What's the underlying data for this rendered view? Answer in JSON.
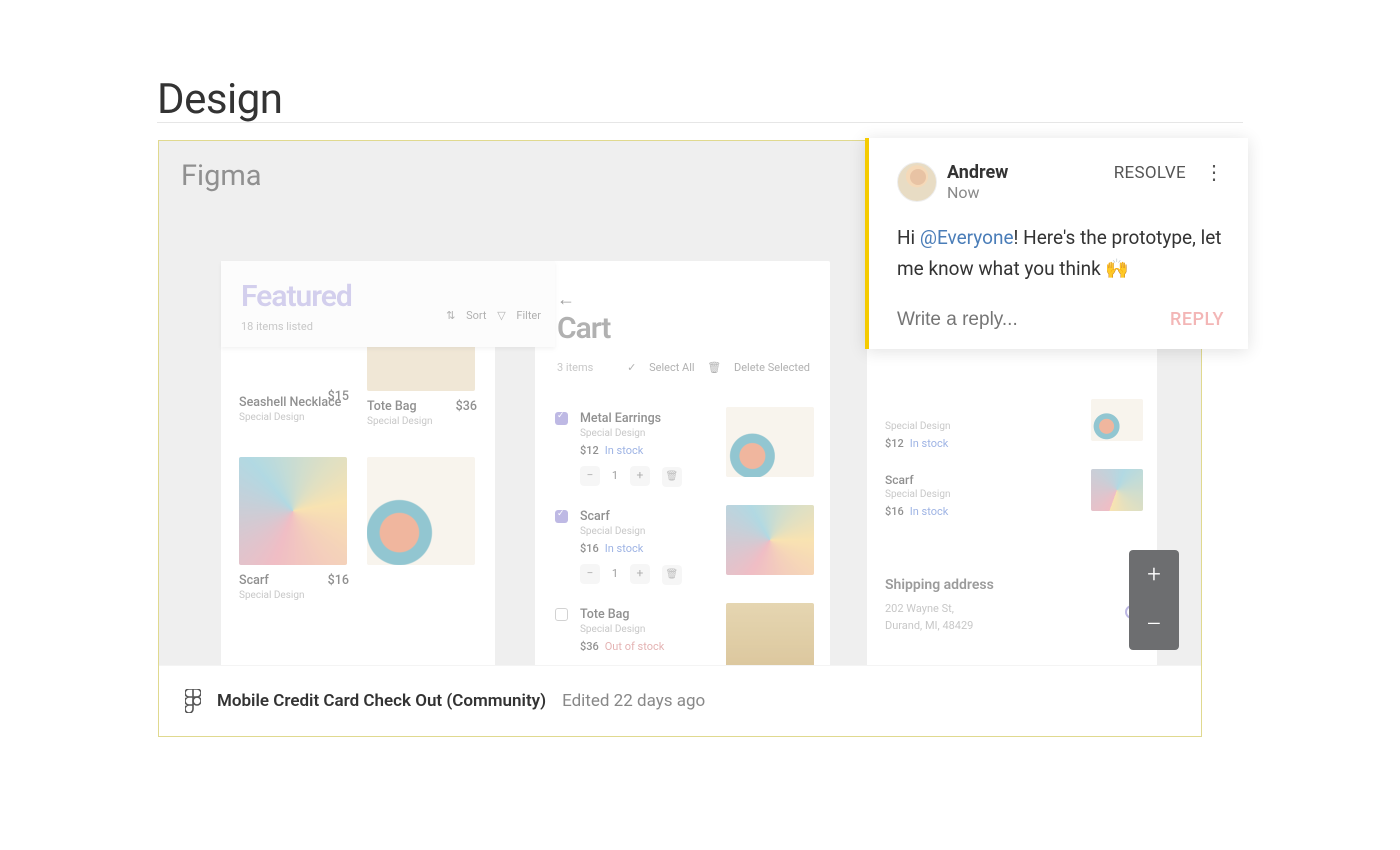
{
  "page": {
    "title": "Design"
  },
  "canvas": {
    "app_label": "Figma"
  },
  "featured": {
    "title": "Featured",
    "subtitle": "18 items listed",
    "sort": "Sort",
    "filter": "Filter"
  },
  "products": {
    "seashell": {
      "name": "Seashell Necklace",
      "sub": "Special Design",
      "price": "$15"
    },
    "tote": {
      "name": "Tote Bag",
      "sub": "Special Design",
      "price": "$36"
    },
    "scarf": {
      "name": "Scarf",
      "sub": "Special Design",
      "price": "$16"
    }
  },
  "cart": {
    "title": "Cart",
    "count": "3 items",
    "select_all": "Select All",
    "delete_selected": "Delete Selected",
    "lines": {
      "earrings": {
        "name": "Metal Earrings",
        "sub": "Special Design",
        "price": "$12",
        "stock": "In stock",
        "qty": "1"
      },
      "scarf": {
        "name": "Scarf",
        "sub": "Special Design",
        "price": "$16",
        "stock": "In stock",
        "qty": "1"
      },
      "tote": {
        "name": "Tote Bag",
        "sub": "Special Design",
        "price": "$36",
        "stock": "Out of stock"
      }
    }
  },
  "rightPanel": {
    "earrings": {
      "sub": "Special Design",
      "price": "$12",
      "stock": "In stock"
    },
    "scarf": {
      "name": "Scarf",
      "sub": "Special Design",
      "price": "$16",
      "stock": "In stock"
    },
    "shipping": {
      "title": "Shipping address",
      "line1": "202 Wayne St,",
      "line2": "Durand, MI, 48429"
    }
  },
  "file": {
    "name": "Mobile Credit Card Check Out (Community)",
    "meta": "Edited 22 days ago"
  },
  "comment": {
    "author": "Andrew",
    "time": "Now",
    "resolve": "RESOLVE",
    "greeting": "Hi ",
    "mention": "@Everyone",
    "body_rest": "! Here's the prototype, let me know what you think 🙌",
    "reply_placeholder": "Write a reply...",
    "reply_button": "REPLY"
  },
  "zoom": {
    "plus": "+",
    "minus": "–"
  }
}
